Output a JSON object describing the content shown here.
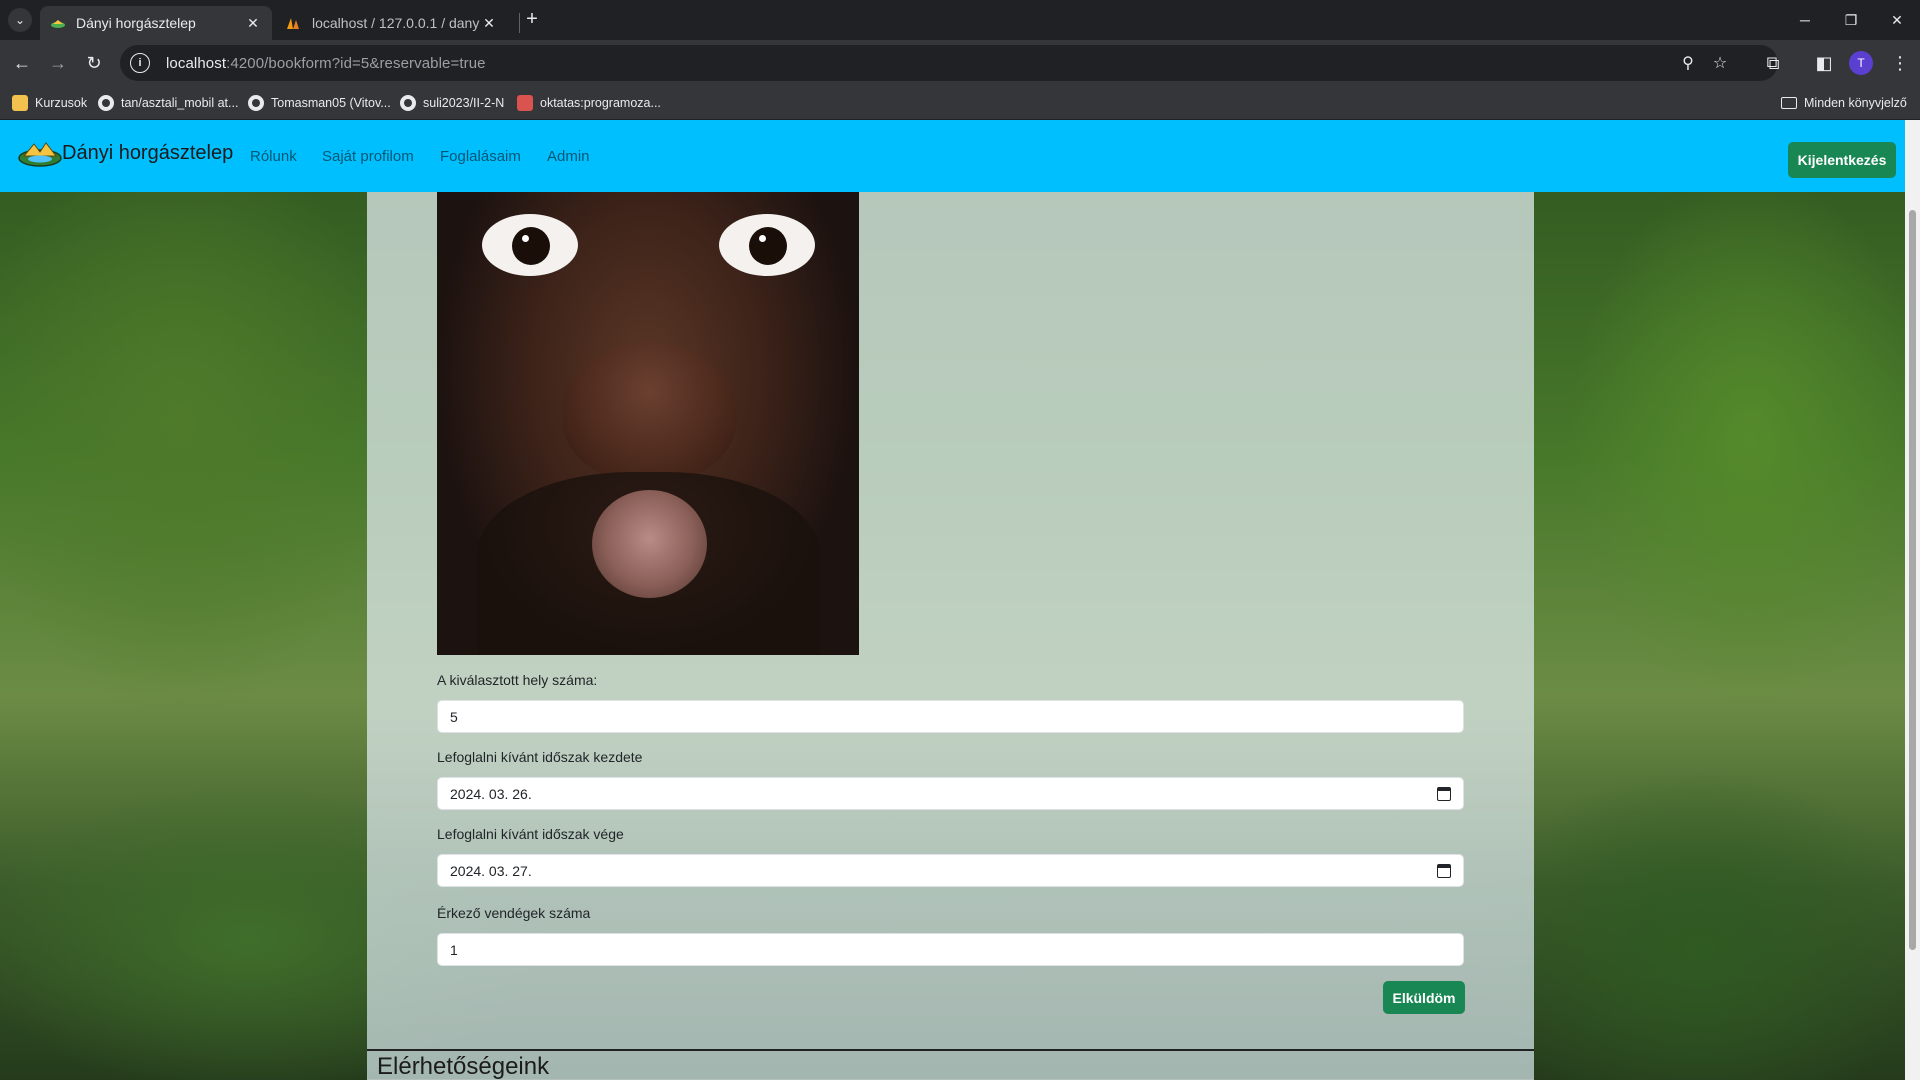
{
  "browser": {
    "tabs": [
      {
        "title": "Dányi horgásztelep",
        "active": true
      },
      {
        "title": "localhost / 127.0.0.1 / danyito /",
        "active": false
      }
    ],
    "url_host": "localhost",
    "url_rest": ":4200/bookform?id=5&reservable=true",
    "profile_initial": "T",
    "bookmarks": [
      "Kurzusok",
      "tan/asztali_mobil at...",
      "Tomasman05 (Vitov...",
      "suli2023/II-2-N",
      "oktatas:programoza..."
    ],
    "all_bookmarks": "Minden könyvjelző"
  },
  "navbar": {
    "brand": "Dányi horgásztelep",
    "links": [
      "Rólunk",
      "Saját profilom",
      "Foglalásaim",
      "Admin"
    ],
    "logout": "Kijelentkezés"
  },
  "form": {
    "place_label": "A kiválasztott hely száma:",
    "place_value": "5",
    "start_label": "Lefoglalni kívánt időszak kezdete",
    "start_value": "2024. 03. 26.",
    "end_label": "Lefoglalni kívánt időszak vége",
    "end_value": "2024. 03. 27.",
    "guests_label": "Érkező vendégek száma",
    "guests_value": "1",
    "submit": "Elküldöm"
  },
  "footer": {
    "title": "Elérhetőségeink"
  },
  "colors": {
    "navbar": "#00bfff",
    "button_green": "#198754"
  }
}
